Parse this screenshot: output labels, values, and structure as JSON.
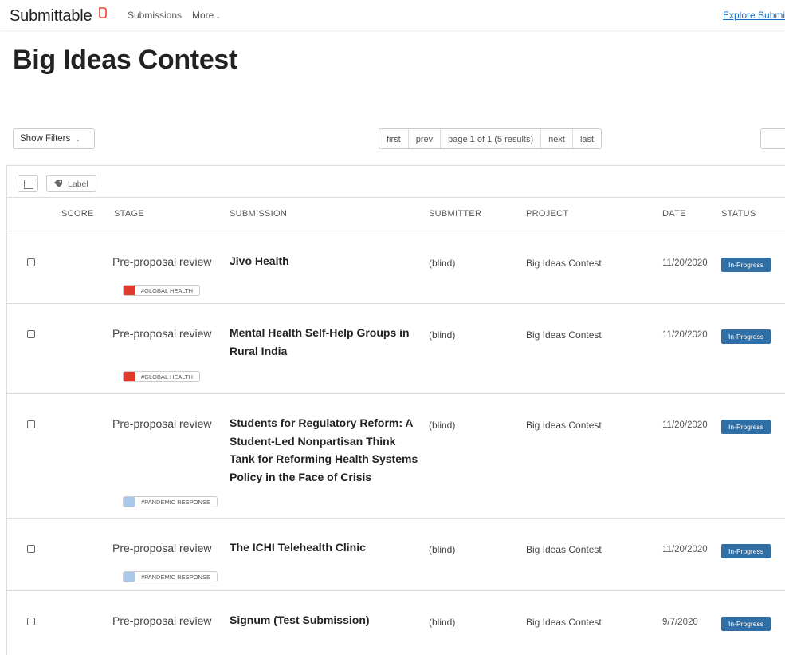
{
  "nav": {
    "brand": "Submittable",
    "submissions": "Submissions",
    "more": "More",
    "explore": "Explore Submi"
  },
  "page": {
    "title": "Big Ideas Contest"
  },
  "controls": {
    "show_filters": "Show Filters",
    "pager": [
      "first",
      "prev",
      "page 1 of 1 (5 results)",
      "next",
      "last"
    ]
  },
  "toolbar": {
    "label": "Label"
  },
  "columns": {
    "score": "SCORE",
    "stage": "STAGE",
    "submission": "SUBMISSION",
    "submitter": "SUBMITTER",
    "project": "PROJECT",
    "date": "DATE",
    "status": "STATUS"
  },
  "colors": {
    "brand_accent": "#e8452c",
    "status_in_progress": "#2f6fa6",
    "tag_global_health": "#e03a2f",
    "tag_pandemic_response": "#a9c8ea",
    "link": "#1a6ec2"
  },
  "rows": [
    {
      "stage": "Pre-proposal review",
      "submission_lines": [
        "Jivo Health"
      ],
      "submitter": "(blind)",
      "project": "Big Ideas Contest",
      "date": "11/20/2020",
      "status": "In-Progress",
      "tag": "#GLOBAL HEALTH"
    },
    {
      "stage": "Pre-proposal review",
      "submission_lines": [
        "Mental Health Self-Help Groups in",
        "Rural India"
      ],
      "submitter": "(blind)",
      "project": "Big Ideas Contest",
      "date": "11/20/2020",
      "status": "In-Progress",
      "tag": "#GLOBAL HEALTH"
    },
    {
      "stage": "Pre-proposal review",
      "submission_lines": [
        "Students for Regulatory Reform: A",
        "Student-Led Nonpartisan Think",
        "Tank for Reforming Health Systems",
        "Policy in the Face of Crisis"
      ],
      "submitter": "(blind)",
      "project": "Big Ideas Contest",
      "date": "11/20/2020",
      "status": "In-Progress",
      "tag": "#PANDEMIC RESPONSE"
    },
    {
      "stage": "Pre-proposal review",
      "submission_lines": [
        "The ICHI Telehealth Clinic"
      ],
      "submitter": "(blind)",
      "project": "Big Ideas Contest",
      "date": "11/20/2020",
      "status": "In-Progress",
      "tag": "#PANDEMIC RESPONSE"
    },
    {
      "stage": "Pre-proposal review",
      "submission_lines": [
        "Signum (Test Submission)"
      ],
      "submitter": "(blind)",
      "project": "Big Ideas Contest",
      "date": "9/7/2020",
      "status": "In-Progress",
      "tag": ""
    }
  ]
}
